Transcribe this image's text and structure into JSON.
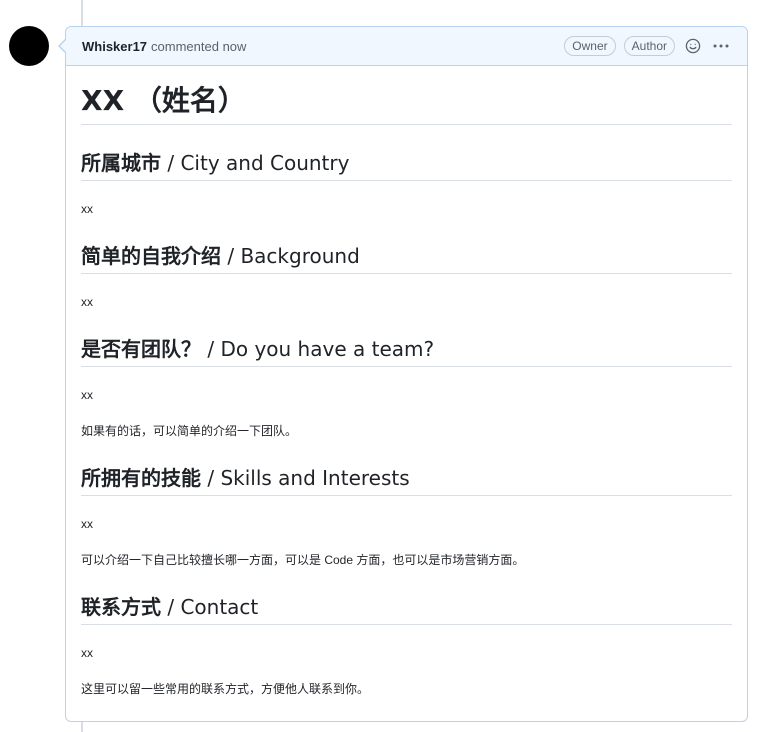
{
  "comment": {
    "author": "Whisker17",
    "meta": "commented now",
    "badges": [
      "Owner",
      "Author"
    ],
    "icons": {
      "reaction": "smiley-icon",
      "more": "kebab-horizontal-icon"
    }
  },
  "document": {
    "title": "XX （姓名）",
    "sections": [
      {
        "heading_zh": "所属城市",
        "heading_en": " / City and Country",
        "value": "xx",
        "note": ""
      },
      {
        "heading_zh": "简单的自我介绍",
        "heading_en": " / Background",
        "value": "xx",
        "note": ""
      },
      {
        "heading_zh": "是否有团队？",
        "heading_en": " / Do you have a team?",
        "value": "xx",
        "note": "如果有的话，可以简单的介绍一下团队。"
      },
      {
        "heading_zh": "所拥有的技能",
        "heading_en": " / Skills and Interests",
        "value": "xx",
        "note": "可以介绍一下自己比较擅长哪一方面，可以是 Code 方面，也可以是市场营销方面。"
      },
      {
        "heading_zh": "联系方式",
        "heading_en": " / Contact",
        "value": "xx",
        "note": "这里可以留一些常用的联系方式，方便他人联系到你。"
      }
    ]
  }
}
